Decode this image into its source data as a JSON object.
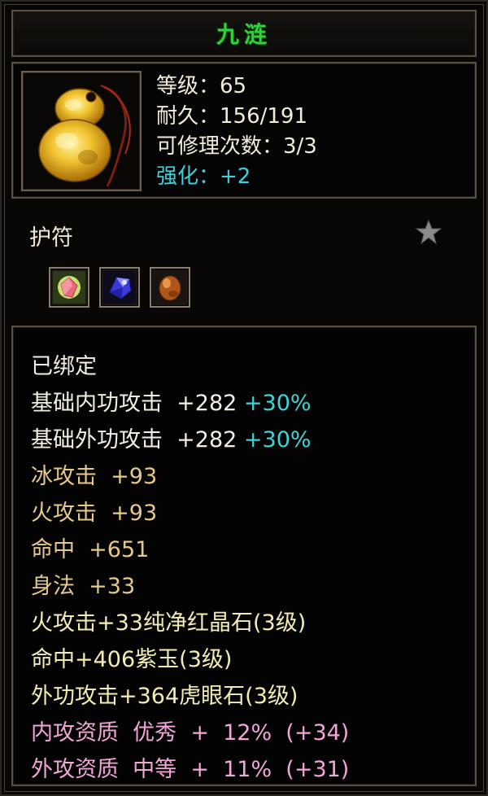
{
  "item": {
    "name": "九涟",
    "level_line": "等级：65",
    "durability_line": "耐久：156/191",
    "repair_line": "可修理次数：3/3",
    "enhance_line": "强化：+2",
    "type": "护符",
    "icon": "jade-amulet-icon",
    "gems": [
      "pink-crystal-gem-icon",
      "purple-jade-gem-icon",
      "tiger-eye-gem-icon"
    ]
  },
  "properties": {
    "bound": "已绑定",
    "base_inner_attack": {
      "text": "基础内功攻击  +282",
      "bonus": "+30%"
    },
    "base_outer_attack": {
      "text": "基础外功攻击  +282",
      "bonus": "+30%"
    },
    "ice_attack": "冰攻击  +93",
    "fire_attack": "火攻击  +93",
    "accuracy": "命中  +651",
    "agility": "身法  +33",
    "socket_1": "火攻击+33纯净红晶石(3级)",
    "socket_2": "命中+406紫玉(3级)",
    "socket_3": "外功攻击+364虎眼石(3级)",
    "inner_aptitude": "内攻资质  优秀  +  12%  (+34)",
    "outer_aptitude": "外攻资质  中等  +  11%  (+31)"
  },
  "colors": {
    "title": "#2fd23a",
    "enhance": "#39d0e0",
    "bonus": "#3fd3d8",
    "base_stat": "#e6c98a",
    "socket": "#f3ecb4",
    "aptitude": "#f0a6d6"
  }
}
